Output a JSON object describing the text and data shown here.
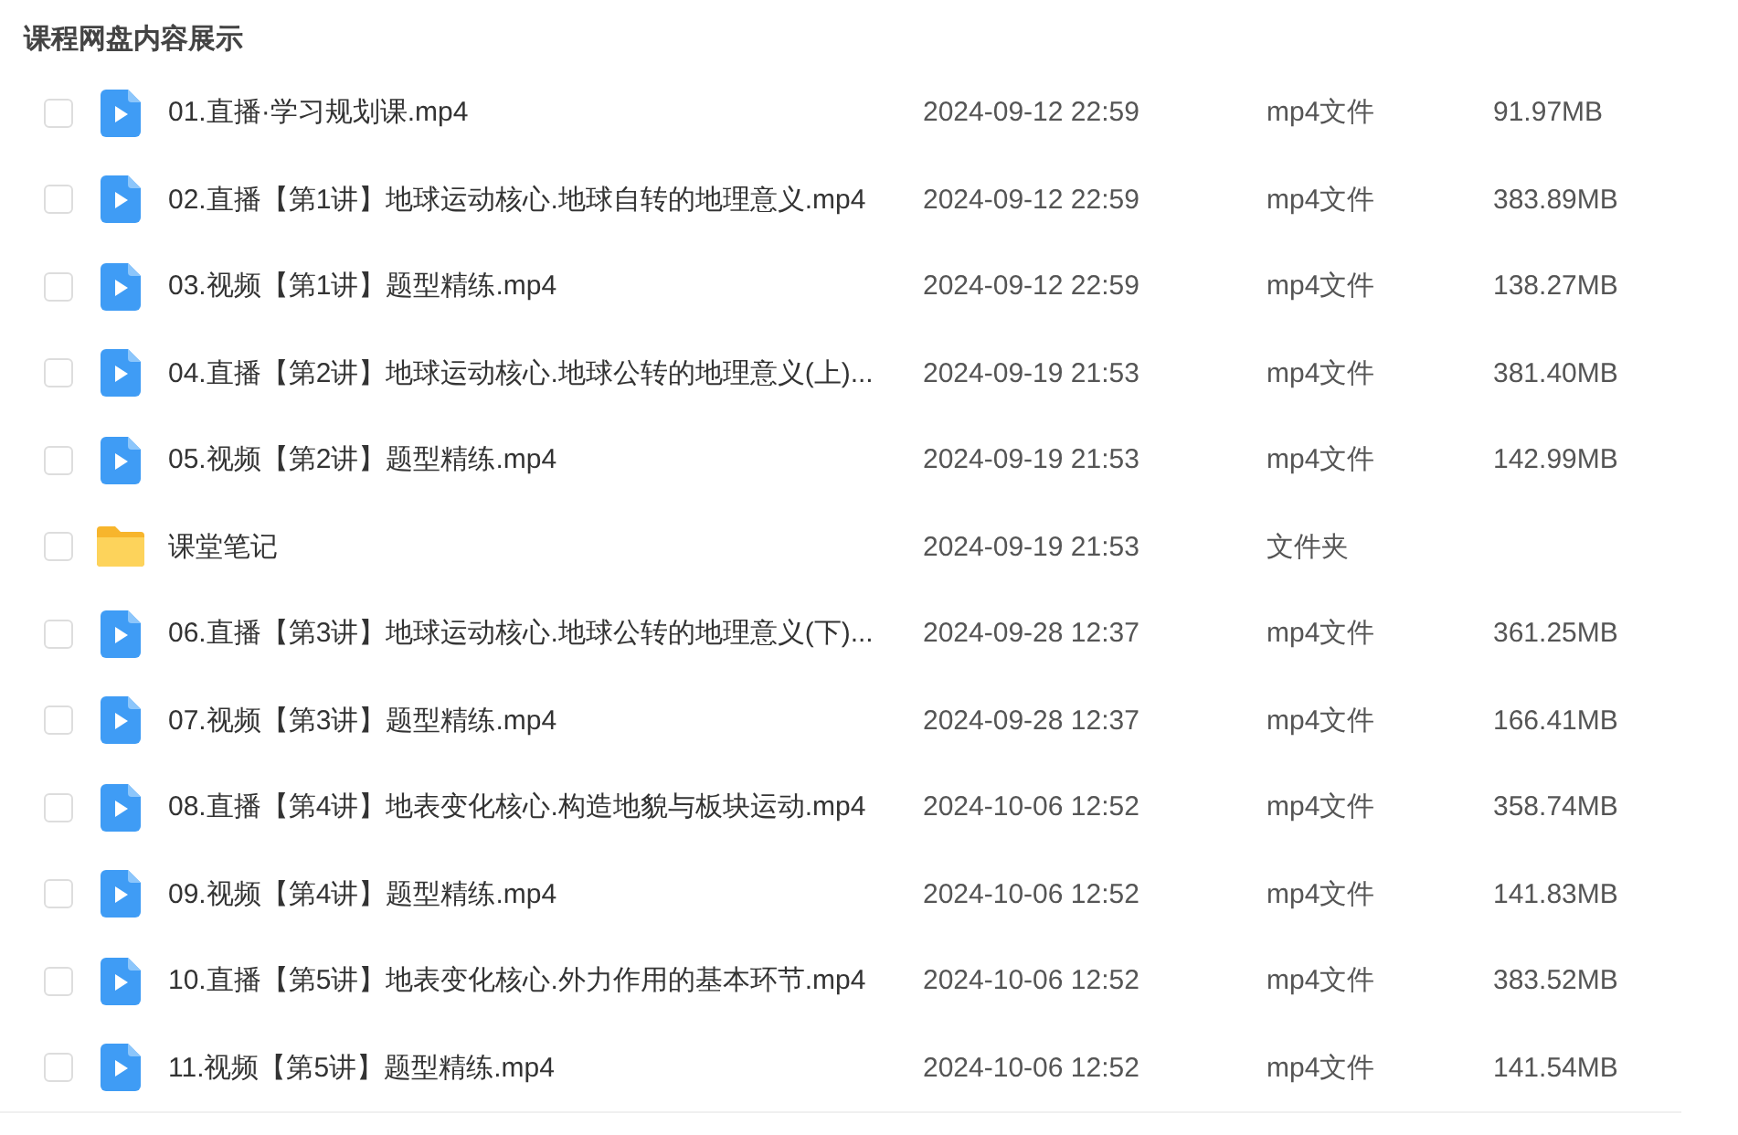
{
  "title": "课程网盘内容展示",
  "files": [
    {
      "kind": "video",
      "checked": false,
      "name": "01.直播·学习规划课.mp4",
      "date": "2024-09-12 22:59",
      "type": "mp4文件",
      "size": "91.97MB"
    },
    {
      "kind": "video",
      "checked": false,
      "name": "02.直播【第1讲】地球运动核心.地球自转的地理意义.mp4",
      "date": "2024-09-12 22:59",
      "type": "mp4文件",
      "size": "383.89MB"
    },
    {
      "kind": "video",
      "checked": false,
      "name": "03.视频【第1讲】题型精练.mp4",
      "date": "2024-09-12 22:59",
      "type": "mp4文件",
      "size": "138.27MB"
    },
    {
      "kind": "video",
      "checked": false,
      "name": "04.直播【第2讲】地球运动核心.地球公转的地理意义(上)...",
      "date": "2024-09-19 21:53",
      "type": "mp4文件",
      "size": "381.40MB"
    },
    {
      "kind": "video",
      "checked": false,
      "name": "05.视频【第2讲】题型精练.mp4",
      "date": "2024-09-19 21:53",
      "type": "mp4文件",
      "size": "142.99MB"
    },
    {
      "kind": "folder",
      "checked": false,
      "name": "课堂笔记",
      "date": "2024-09-19 21:53",
      "type": "文件夹"
    },
    {
      "kind": "video",
      "checked": false,
      "name": "06.直播【第3讲】地球运动核心.地球公转的地理意义(下)...",
      "date": "2024-09-28 12:37",
      "type": "mp4文件",
      "size": "361.25MB"
    },
    {
      "kind": "video",
      "checked": false,
      "name": "07.视频【第3讲】题型精练.mp4",
      "date": "2024-09-28 12:37",
      "type": "mp4文件",
      "size": "166.41MB"
    },
    {
      "kind": "video",
      "checked": false,
      "name": "08.直播【第4讲】地表变化核心.构造地貌与板块运动.mp4",
      "date": "2024-10-06 12:52",
      "type": "mp4文件",
      "size": "358.74MB"
    },
    {
      "kind": "video",
      "checked": false,
      "name": "09.视频【第4讲】题型精练.mp4",
      "date": "2024-10-06 12:52",
      "type": "mp4文件",
      "size": "141.83MB"
    },
    {
      "kind": "video",
      "checked": false,
      "name": "10.直播【第5讲】地表变化核心.外力作用的基本环节.mp4",
      "date": "2024-10-06 12:52",
      "type": "mp4文件",
      "size": "383.52MB"
    },
    {
      "kind": "video",
      "checked": false,
      "name": "11.视频【第5讲】题型精练.mp4",
      "date": "2024-10-06 12:52",
      "type": "mp4文件",
      "size": "141.54MB"
    }
  ]
}
